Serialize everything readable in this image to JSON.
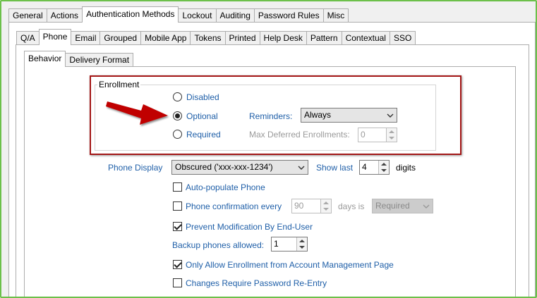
{
  "top_tabs": [
    "General",
    "Actions",
    "Authentication Methods",
    "Lockout",
    "Auditing",
    "Password Rules",
    "Misc"
  ],
  "method_tabs": [
    "Q/A",
    "Phone",
    "Email",
    "Grouped",
    "Mobile App",
    "Tokens",
    "Printed",
    "Help Desk",
    "Pattern",
    "Contextual",
    "SSO"
  ],
  "sub_tabs": [
    "Behavior",
    "Delivery Format"
  ],
  "enrollment": {
    "group_label": "Enrollment",
    "options": [
      "Disabled",
      "Optional",
      "Required"
    ],
    "selected": "Optional",
    "reminders_label": "Reminders:",
    "reminders_value": "Always",
    "max_deferred_label": "Max Deferred Enrollments:",
    "max_deferred_value": "0"
  },
  "phone_display": {
    "label": "Phone Display",
    "value": "Obscured ('xxx-xxx-1234')",
    "show_last_label": "Show last",
    "show_last_value": "4",
    "digits_label": "digits"
  },
  "options": {
    "auto_populate": {
      "label": "Auto-populate Phone",
      "checked": false
    },
    "confirmation": {
      "label": "Phone confirmation every",
      "checked": false,
      "interval": "90",
      "days_label": "days is",
      "requirement": "Required"
    },
    "prevent_modification": {
      "label": "Prevent Modification By End-User",
      "checked": true
    },
    "backup_label": "Backup phones allowed:",
    "backup_value": "1",
    "only_allow_enrollment": {
      "label": "Only Allow Enrollment from Account Management Page",
      "checked": true
    },
    "require_password": {
      "label": "Changes Require Password Re-Entry",
      "checked": false
    }
  },
  "colors": {
    "frame": "#6cc04a",
    "highlight_box": "#a31515",
    "arrow": "#c00000",
    "label_blue": "#1f5fa8"
  }
}
